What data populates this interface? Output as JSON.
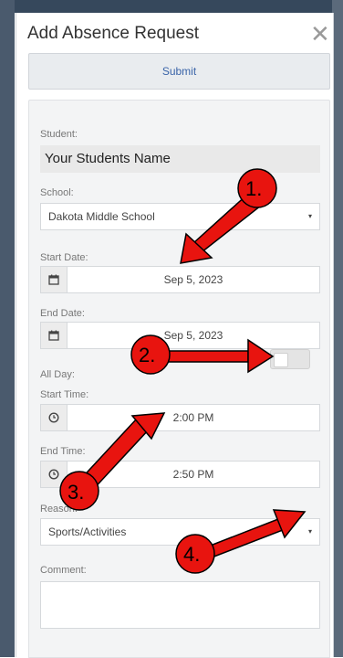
{
  "modal": {
    "title": "Add Absence Request",
    "close_glyph": "✕",
    "submit_label": "Submit"
  },
  "form": {
    "student_label": "Student:",
    "student_value": "Your Students Name",
    "school_label": "School:",
    "school_value": "Dakota Middle School",
    "start_date_label": "Start Date:",
    "start_date_value": "Sep 5, 2023",
    "end_date_label": "End Date:",
    "end_date_value": "Sep 5, 2023",
    "all_day_label": "All Day:",
    "all_day_on": false,
    "start_time_label": "Start Time:",
    "start_time_value": "2:00 PM",
    "end_time_label": "End Time:",
    "end_time_value": "2:50 PM",
    "reason_label": "Reason:",
    "reason_value": "Sports/Activities",
    "comment_label": "Comment:",
    "comment_value": "",
    "select_caret": "▾"
  },
  "annotations": {
    "arrow_color": "#e8140f",
    "markers": [
      "1.",
      "2.",
      "3.",
      "4."
    ]
  }
}
